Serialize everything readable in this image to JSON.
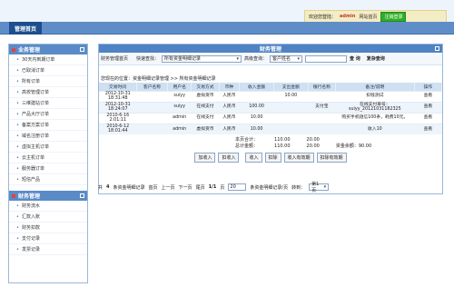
{
  "header": {
    "welcome": "欢迎您登陆：",
    "username": "admin",
    "site_home": "网站首页",
    "logout": "注销登录"
  },
  "nav": {
    "tab": "管理首页"
  },
  "sidebar": {
    "sec1": "业务管理",
    "sec1_items": [
      "30天内到期订单",
      "已取消订单",
      "所有订单",
      "高校管理订单",
      "三维建站订单",
      "产品大厅订单",
      "备案方案订单",
      "域名注册订单",
      "虚拟主机订单",
      "云主机订单",
      "服务器订单",
      "短信产品"
    ],
    "sec2": "财务管理",
    "sec2_items": [
      "财务流水",
      "汇款入账",
      "财务扣款",
      "支付记录",
      "发票记录"
    ]
  },
  "main": {
    "title": "财务管理",
    "filter": {
      "label": "财务管理首页",
      "quick": "快速查找：",
      "quick_value": "所有资金明细记录",
      "adv": "高级查询：",
      "adv_value": "客户姓名",
      "search": "查 询",
      "complex": "复杂查询"
    },
    "crumb": "您现在的位置：资金明细记录管理 >> 所有资金明细记录",
    "columns": [
      "交易时间",
      "客户名称",
      "用户名",
      "交易方式",
      "币种",
      "收入金额",
      "支出金额",
      "银行名称",
      "备注/说明",
      "操作"
    ],
    "rows": [
      [
        "2012-10-31 18:31:48",
        "",
        "suiyy",
        "虚拟货币",
        "人民币",
        "",
        "10.00",
        "",
        "扣钱测试",
        "查看"
      ],
      [
        "2012-10-31 18:24:07",
        "",
        "suiyy",
        "在线支付",
        "人民币",
        "100.00",
        "",
        "支付宝",
        "在线支付单号：suiyy_20121031182325",
        "查看"
      ],
      [
        "2010-6-16 2:01:11",
        "",
        "admin",
        "在线支付",
        "人民币",
        "10.00",
        "",
        "",
        "购买手机短信100条，耗费10元。",
        "查看"
      ],
      [
        "2010-6-12 18:01:44",
        "",
        "admin",
        "虚拟货币",
        "人民币",
        "10.00",
        "",
        "",
        "收入10",
        "查看"
      ]
    ],
    "summary": [
      {
        "label": "本页合计：",
        "income": "110.00",
        "expense": "20.00"
      },
      {
        "label": "总计金额：",
        "income": "110.00",
        "expense": "20.00",
        "balance": "资金余额：90.00"
      }
    ],
    "actions": [
      "加收入",
      "扣收入",
      "收入",
      "扣除",
      "收入有效期",
      "扣除有效期"
    ],
    "pager": {
      "total_prefix": "共",
      "total": "4",
      "total_suffix": "条资金明细记录",
      "first": "首页",
      "prev": "上一页",
      "next": "下一页",
      "last": "尾页",
      "page": "1/1",
      "page_suffix": "页",
      "per_page": "20",
      "per_suffix": "条资金明细记录/页",
      "goto": "转到：",
      "goto_value": "第1页"
    }
  }
}
